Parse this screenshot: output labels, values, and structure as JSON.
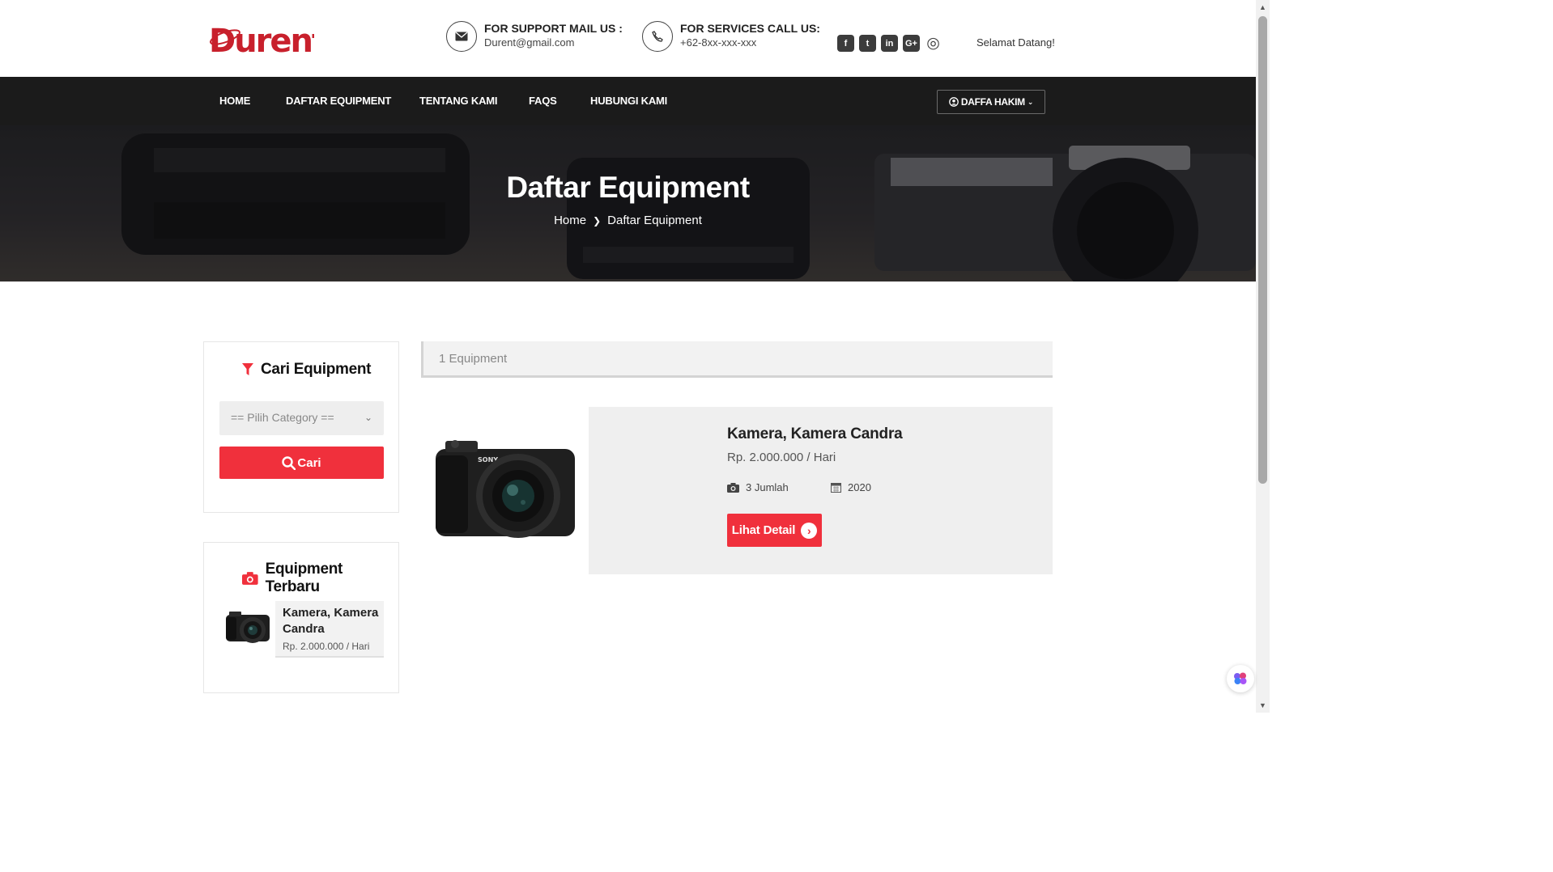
{
  "brand": {
    "logo_text": "Durent",
    "accent_color": "#f0303c"
  },
  "header": {
    "support": {
      "title": "FOR SUPPORT MAIL US :",
      "value": "Durent@gmail.com",
      "icon": "envelope-icon"
    },
    "services": {
      "title": "FOR SERVICES CALL US:",
      "value": "+62-8xx-xxx-xxx",
      "icon": "phone-icon"
    },
    "socials": [
      {
        "name": "facebook",
        "glyph": "f"
      },
      {
        "name": "twitter",
        "glyph": "t"
      },
      {
        "name": "linkedin",
        "glyph": "in"
      },
      {
        "name": "google-plus",
        "glyph": "G+"
      },
      {
        "name": "instagram",
        "glyph": "◎"
      }
    ],
    "welcome": "Selamat Datang!"
  },
  "nav": {
    "items": [
      "HOME",
      "DAFTAR EQUIPMENT",
      "TENTANG KAMI",
      "FAQS",
      "HUBUNGI KAMI"
    ],
    "user": "DAFFA HAKIM"
  },
  "banner": {
    "title": "Daftar Equipment",
    "breadcrumb": [
      "Home",
      "Daftar Equipment"
    ]
  },
  "sidebar": {
    "search": {
      "title": "Cari Equipment",
      "select_value": "== Pilih Category ==",
      "button": "Cari"
    },
    "latest": {
      "title": "Equipment Terbaru",
      "items": [
        {
          "name": "Kamera, Kamera Candra",
          "price": "Rp. 2.000.000 / Hari"
        }
      ]
    }
  },
  "results": {
    "count": "1 Equipment",
    "items": [
      {
        "name": "Kamera, Kamera Candra",
        "price": "Rp. 2.000.000 / Hari",
        "quantity": "3 Jumlah",
        "year": "2020",
        "button": "Lihat Detail"
      }
    ]
  }
}
